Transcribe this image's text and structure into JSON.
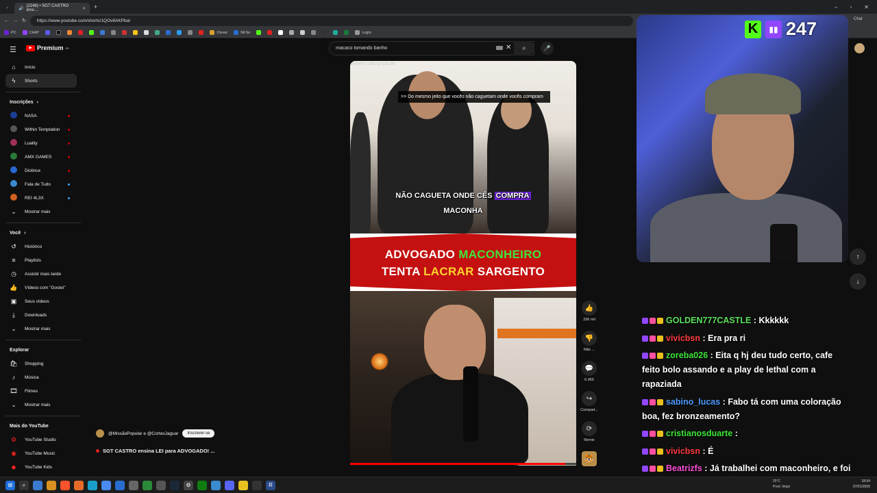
{
  "browser": {
    "tab_title": "(2248) • SGT CASTRO ensi…",
    "url": "https://www.youtube.com/shorts/1QOv8AKPbaI",
    "bookmarks": [
      "PC",
      "CHAT",
      "Clever",
      "NFSe",
      "Login"
    ]
  },
  "youtube": {
    "logo": "Premium",
    "logo_region": "BR",
    "search_query": "macaco tomando banho"
  },
  "sidebar": {
    "main": [
      {
        "label": "Início",
        "icon": "home-icon"
      },
      {
        "label": "Shorts",
        "icon": "shorts-icon"
      }
    ],
    "subs_title": "Inscrições",
    "subs": [
      {
        "label": "NASA",
        "color": "#1b3f95",
        "dot": "red"
      },
      {
        "label": "Within Temptation",
        "color": "#555",
        "dot": "red"
      },
      {
        "label": "Luality",
        "color": "#a0305a",
        "dot": "red"
      },
      {
        "label": "AMX GAMES",
        "color": "#2a7a3a",
        "dot": "red"
      },
      {
        "label": "Diolinux",
        "color": "#2a66d0",
        "dot": "red"
      },
      {
        "label": "Fala de Tudo",
        "color": "#3a8ad0",
        "dot": "blue"
      },
      {
        "label": "REI 4L3X",
        "color": "#d06020",
        "dot": "blue"
      },
      {
        "label": "Mostrar mais",
        "color": "",
        "dot": ""
      }
    ],
    "you_title": "Você",
    "you": [
      {
        "label": "Histórico",
        "icon": "history-icon"
      },
      {
        "label": "Playlists",
        "icon": "playlists-icon"
      },
      {
        "label": "Assistir mais tarde",
        "icon": "watch-later-icon"
      },
      {
        "label": "Vídeos com \"Gostei\"",
        "icon": "like-icon"
      },
      {
        "label": "Seus vídeos",
        "icon": "your-videos-icon"
      },
      {
        "label": "Downloads",
        "icon": "download-icon"
      },
      {
        "label": "Mostrar mais",
        "icon": "chevron-down-icon"
      }
    ],
    "explore_title": "Explorar",
    "explore": [
      {
        "label": "Shopping",
        "icon": "shopping-icon"
      },
      {
        "label": "Música",
        "icon": "music-icon"
      },
      {
        "label": "Filmes",
        "icon": "film-icon"
      },
      {
        "label": "Mostrar mais",
        "icon": "chevron-down-icon"
      }
    ],
    "more_title": "Mais do YouTube",
    "more": [
      {
        "label": "YouTube Studio"
      },
      {
        "label": "YouTube Music"
      },
      {
        "label": "YouTube Kids"
      }
    ]
  },
  "short": {
    "ghost_text": "onheiro não gosta de",
    "cc_caption": ">> Do mesmo jeito que vocês não caguetam onde vocês compram",
    "burn_sub_a": "NÃO CAGUETA ONDE CÊS",
    "burn_sub_hl": "COMPRA",
    "burn_sub_b": "MACONHA",
    "banner_line1_a": "ADVOGADO",
    "banner_line1_b": "MACONHEIRO",
    "banner_line2_a": "TENTA",
    "banner_line2_b": "LACRAR",
    "banner_line2_c": "SARGENTO",
    "progress": 0.95,
    "channel": "@MissãoPopular e @CortesJaguar",
    "subscribe": "Inscrever-se",
    "title": "SGT CASTRO ensina LEI para ADVOGADO! ...",
    "actions": {
      "likes": "336 mil",
      "dislike": "Não ...",
      "comments": "6.965",
      "share": "Compart...",
      "remix": "Remix"
    }
  },
  "overlay": {
    "viewer_count": "247",
    "chat_label": "Chat",
    "messages": [
      {
        "user": "GOLDEN777CASTLE",
        "color": "#5ae05a",
        "text": ": Kkkkkk"
      },
      {
        "user": "vivicbsn",
        "color": "#ff3b3b",
        "text": ": Era pra ri"
      },
      {
        "user": "zoreba026",
        "color": "#3ee63a",
        "text": ": Eita q hj deu tudo certo, cafe feito bolo assando e a play de lethal com a rapaziada"
      },
      {
        "user": "sabino_lucas",
        "color": "#4d9bff",
        "text": ": Fabo tá com uma coloração boa, fez bronzeamento?"
      },
      {
        "user": "cristianosduarte",
        "color": "#3ee63a",
        "text": ":"
      },
      {
        "user": "vivicbsn",
        "color": "#ff3b3b",
        "text": ": É"
      },
      {
        "user": "Beatrizfs",
        "color": "#ff4fd8",
        "text": ": Já trabalhei com maconheiro, e foi um inferno"
      }
    ]
  },
  "taskbar": {
    "weather_temp": "25°C",
    "weather_desc": "Pred. limpo",
    "time": "18:54",
    "date": "07/01/2026"
  }
}
